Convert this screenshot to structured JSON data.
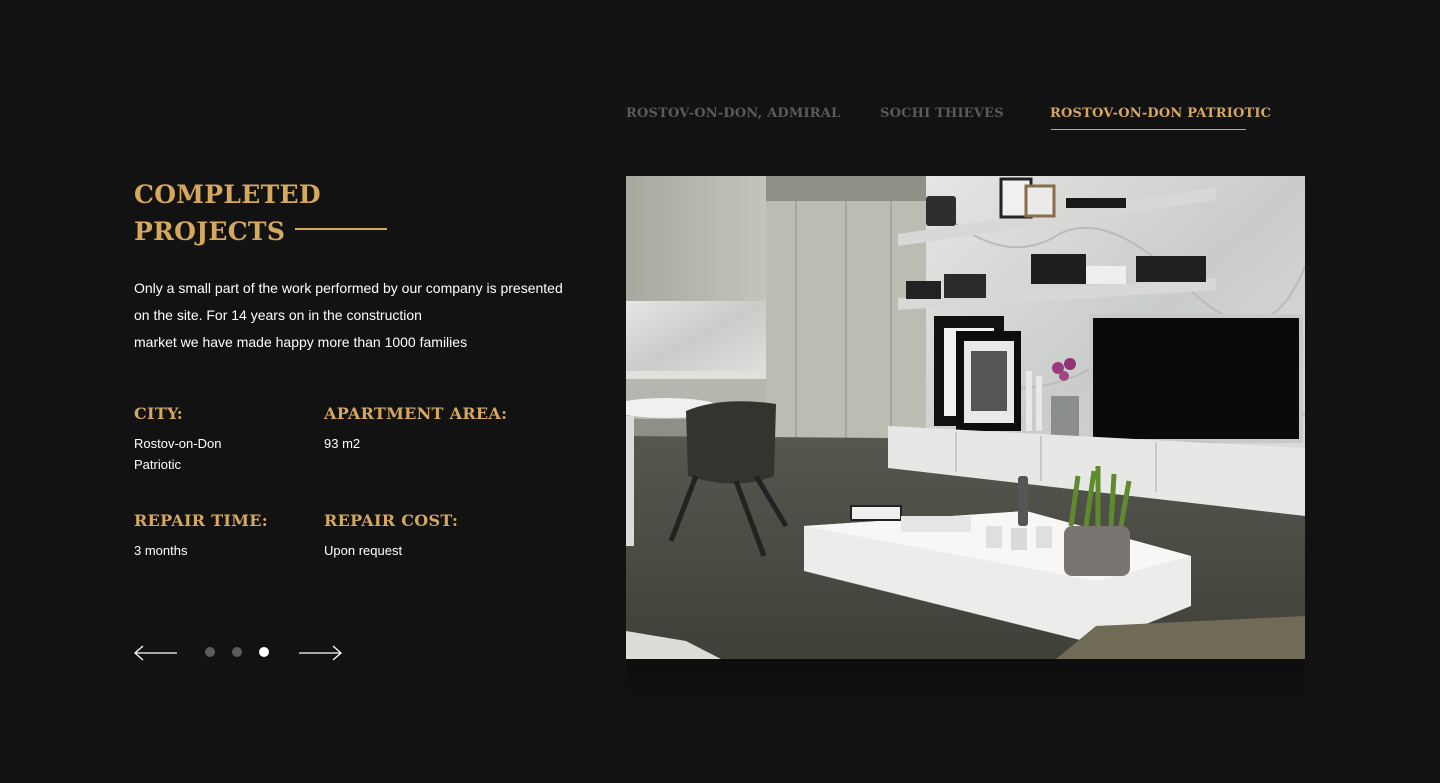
{
  "tabs": [
    {
      "label": "Rostov-on-Don, Admiral",
      "active": false
    },
    {
      "label": "Sochi Thieves",
      "active": false
    },
    {
      "label": "Rostov-on-Don Patriotic",
      "active": true
    }
  ],
  "heading": {
    "line1": "Completed",
    "line2": "Projects"
  },
  "description": {
    "line1": "Only a small part of the work performed by our company is presented",
    "line2": "on the site. For 14 years on in the construction",
    "line3": "market we have made happy more than 1000 families"
  },
  "info": {
    "city": {
      "label": "City:",
      "value_line1": "Rostov-on-Don",
      "value_line2": "Patriotic"
    },
    "area": {
      "label": "Apartment area:",
      "value": "93 m2"
    },
    "time": {
      "label": "Repair time:",
      "value": "3 months"
    },
    "cost": {
      "label": "Repair cost:",
      "value": "Upon request"
    }
  },
  "slider": {
    "total": 3,
    "active_index": 3,
    "prev_icon": "arrow-left-icon",
    "next_icon": "arrow-right-icon"
  },
  "colors": {
    "background": "#121213",
    "accent": "#d5a85e",
    "text": "#ffffff",
    "muted": "#5a5a5a"
  }
}
